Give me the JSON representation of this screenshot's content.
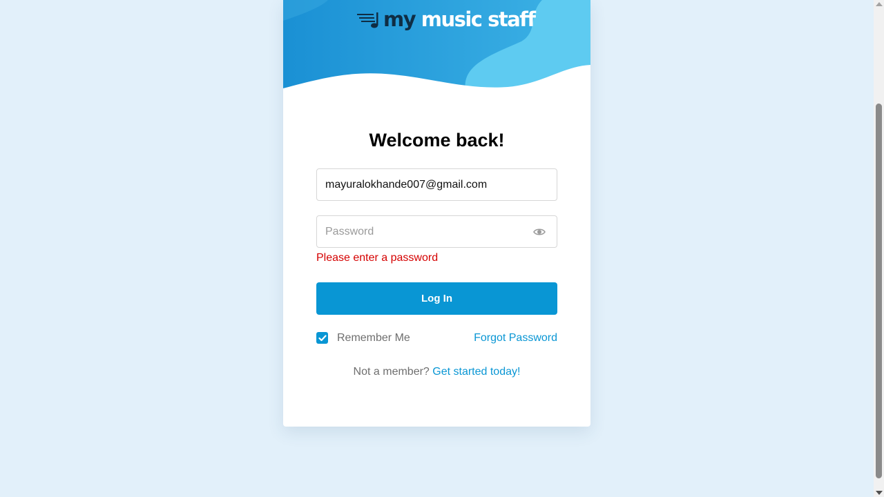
{
  "brand": {
    "logo_prefix": "my",
    "logo_suffix": " music staff"
  },
  "colors": {
    "accent": "#0996d4",
    "error": "#d50000",
    "background": "#e2f0fa"
  },
  "login": {
    "title": "Welcome back!",
    "email_value": "mayuralokhande007@gmail.com",
    "password_placeholder": "Password",
    "password_icon": "eye-icon",
    "error": "Please enter a password",
    "submit_label": "Log In",
    "remember_label": "Remember Me",
    "remember_checked": true,
    "forgot_label": "Forgot Password",
    "signup_prompt": "Not a member?",
    "signup_link": "Get started today!"
  }
}
